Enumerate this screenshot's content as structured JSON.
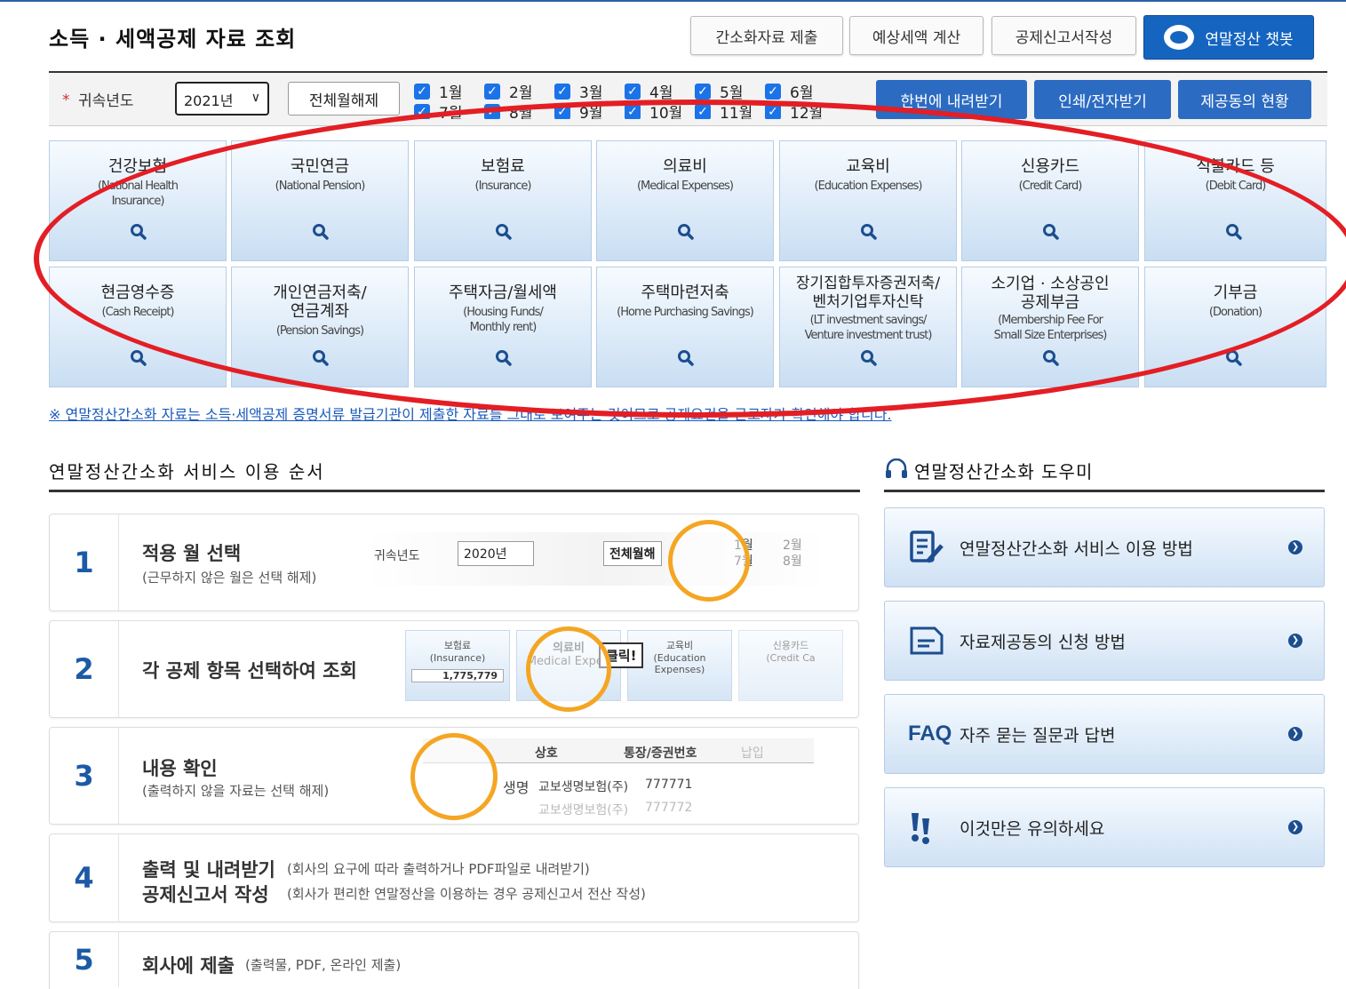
{
  "header": {
    "title": "소득 · 세액공제 자료 조회",
    "buttons": [
      "간소화자료 제출",
      "예상세액 계산",
      "공제신고서작성"
    ],
    "chatbot": "연말정산 챗봇"
  },
  "filter": {
    "year_label": "귀속년도",
    "year_value": "2021년",
    "all_label": "전체월해제",
    "months": [
      "1월",
      "2월",
      "3월",
      "4월",
      "5월",
      "6월",
      "7월",
      "8월",
      "9월",
      "10월",
      "11월",
      "12월"
    ],
    "actions": [
      "한번에 내려받기",
      "인쇄/전자받기",
      "제공동의 현황"
    ]
  },
  "tiles": [
    {
      "ko": "건강보험",
      "en": "(National Health\nInsurance)"
    },
    {
      "ko": "국민연금",
      "en": "(National Pension)"
    },
    {
      "ko": "보험료",
      "en": "(Insurance)"
    },
    {
      "ko": "의료비",
      "en": "(Medical Expenses)"
    },
    {
      "ko": "교육비",
      "en": "(Education Expenses)"
    },
    {
      "ko": "신용카드",
      "en": "(Credit Card)"
    },
    {
      "ko": "직불카드 등",
      "en": "(Debit Card)"
    },
    {
      "ko": "현금영수증",
      "en": "(Cash Receipt)"
    },
    {
      "ko": "개인연금저축/\n연금계좌",
      "en": "(Pension Savings)"
    },
    {
      "ko": "주택자금/월세액",
      "en": "(Housing Funds/\nMonthly rent)"
    },
    {
      "ko": "주택마련저축",
      "en": "(Home Purchasing Savings)"
    },
    {
      "ko": "장기집합투자증권저축/\n벤처기업투자신탁",
      "en": "(LT investment savings/\nVenture investment trust)"
    },
    {
      "ko": "소기업 · 소상공인\n공제부금",
      "en": "(Membership Fee For\nSmall Size Enterprises)"
    },
    {
      "ko": "기부금",
      "en": "(Donation)"
    }
  ],
  "notice": "※ 연말정산간소화 자료는 소득·세액공제 증명서류 발급기관이 제출한 자료를 그대로 보여주는 것이므로 공제요건을 근로자가 확인해야 합니다.",
  "steps_section": {
    "title": "연말정산간소화 서비스 이용 순서",
    "steps": [
      {
        "num": "1",
        "title": "적용 월 선택",
        "sub": "(근무하지 않은 월은 선택 해제)"
      },
      {
        "num": "2",
        "title": "각 공제 항목 선택하여 조회",
        "sub": ""
      },
      {
        "num": "3",
        "title": "내용 확인",
        "sub": "(출력하지 않을 자료는 선택 해제)"
      },
      {
        "num": "4",
        "title": "출력 및 내려받기",
        "title2": "공제신고서 작성",
        "note1": "(회사의 요구에 따라 출력하거나 PDF파일로 내려받기)",
        "note2": "(회사가 편리한 연말정산을 이용하는 경우 공제신고서 전산 작성)"
      },
      {
        "num": "5",
        "title": "회사에 제출",
        "note1": "(출력물, PDF, 온라인 제출)"
      }
    ],
    "illus1": {
      "year_label": "귀속년도",
      "year": "2020년",
      "all": "전체월해",
      "m1": "1월",
      "m7": "7월",
      "m2": "2월",
      "m8": "8월"
    },
    "illus2": {
      "t1": "보험료",
      "t1en": "(Insurance)",
      "amount": "1,775,779",
      "t2": "의료비",
      "t2en": "Medical Expen",
      "click": "클릭!",
      "t3": "교육비",
      "t3en": "(Education Expenses)",
      "t4": "신용카드",
      "t4en": "(Credit Ca"
    },
    "illus3": {
      "h1": "상호",
      "h2": "통장/증권번호",
      "h3": "납입",
      "row1name": "생명",
      "row1co": "교보생명보험(주)",
      "row1no": "777771",
      "row2co": "교보생명보험(주)",
      "row2no": "777772"
    }
  },
  "helper": {
    "title": "연말정산간소화 도우미",
    "items": [
      {
        "icon": "edit-doc-icon",
        "label": "연말정산간소화 서비스 이용 방법"
      },
      {
        "icon": "document-icon",
        "label": "자료제공동의 신청 방법"
      },
      {
        "icon": "faq-icon",
        "label": "자주 묻는 질문과 답변",
        "icon_text": "FAQ"
      },
      {
        "icon": "warning-icon",
        "label": "이것만은 유의하세요"
      }
    ]
  }
}
